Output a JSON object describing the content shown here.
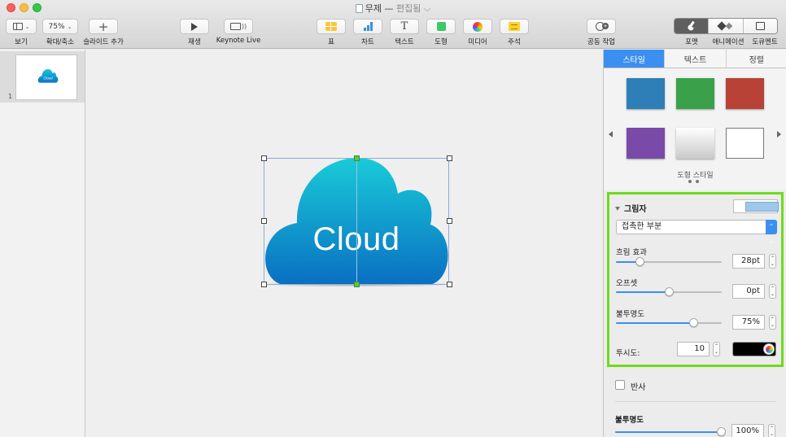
{
  "window": {
    "title": "무제",
    "title_sep": "—",
    "state": "편집됨 ⌵"
  },
  "toolbar": {
    "view_label": "보기",
    "zoom_value": "75%",
    "zoom_label": "확대/축소",
    "add_slide_label": "슬라이드 추가",
    "play_label": "재생",
    "keynote_live_label": "Keynote Live",
    "table_label": "표",
    "chart_label": "차트",
    "text_label": "텍스트",
    "shape_label": "도형",
    "media_label": "미디어",
    "comment_label": "주석",
    "collab_label": "공동 작업",
    "format_label": "포맷",
    "animate_label": "애니메이션",
    "document_label": "도큐멘트"
  },
  "navigator": {
    "slide_number": "1",
    "thumb_text": "Cloud"
  },
  "canvas": {
    "cloud_text": "Cloud",
    "cloud_color_top": "#19c8d8",
    "cloud_color_bottom": "#0b72c4"
  },
  "inspector": {
    "tabs": [
      "스타일",
      "텍스트",
      "정렬"
    ],
    "active_tab": "스타일",
    "swatches": [
      "#2e7fb8",
      "#3aa14a",
      "#b94236",
      "#7a4aa8",
      "#d8d8d8",
      "#ffffff"
    ],
    "styles_caption": "도형 스타일",
    "shadow": {
      "title": "그림자",
      "type_value": "접촉한 부분",
      "blur_label": "흐림 효과",
      "blur_value": "28pt",
      "blur_fraction": 0.22,
      "offset_label": "오프셋",
      "offset_value": "0pt",
      "offset_fraction": 0.5,
      "opacity_label": "불투명도",
      "opacity_value": "75%",
      "opacity_fraction": 0.73,
      "perspective_label": "투시도:",
      "perspective_value": "10",
      "color": "#000000"
    },
    "reflection_label": "반사",
    "opacity_label": "불투명도",
    "opacity_value": "100%",
    "opacity_fraction": 1.0,
    "highlight_color": "#6edb1e"
  }
}
